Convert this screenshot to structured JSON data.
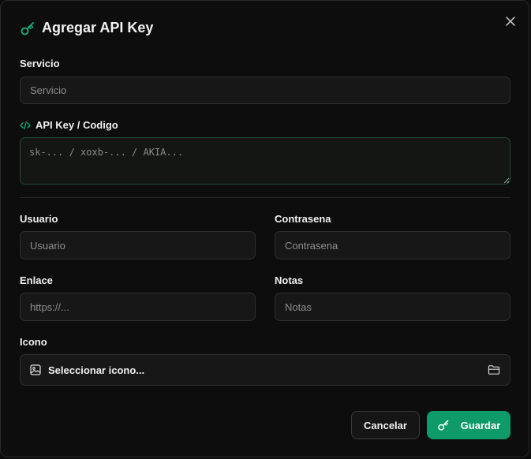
{
  "dialog": {
    "title": "Agregar API Key",
    "close_icon": "close-icon",
    "title_icon": "key-icon",
    "accent_color": "#0f9a6a"
  },
  "fields": {
    "servicio": {
      "label": "Servicio",
      "placeholder": "Servicio",
      "value": ""
    },
    "api_key": {
      "label": "API Key / Codigo",
      "icon": "code-icon",
      "placeholder": "sk-... / xoxb-... / AKIA...",
      "value": ""
    },
    "usuario": {
      "label": "Usuario",
      "placeholder": "Usuario",
      "value": ""
    },
    "contrasena": {
      "label": "Contrasena",
      "placeholder": "Contrasena",
      "value": ""
    },
    "enlace": {
      "label": "Enlace",
      "placeholder": "https://...",
      "value": ""
    },
    "notas": {
      "label": "Notas",
      "placeholder": "Notas",
      "value": ""
    },
    "icono": {
      "label": "Icono",
      "button_label": "Seleccionar icono...",
      "left_icon": "image-icon",
      "right_icon": "folder-icon"
    }
  },
  "actions": {
    "cancel_label": "Cancelar",
    "save_label": "Guardar",
    "save_icon": "key-icon"
  }
}
